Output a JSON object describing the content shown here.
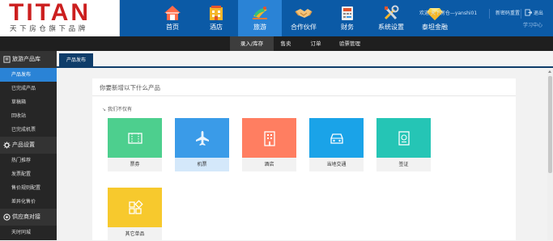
{
  "logo": {
    "title": "TITAN",
    "subtitle": "天下房仓旗下品牌"
  },
  "nav": [
    {
      "label": "首页",
      "icon": "home-icon"
    },
    {
      "label": "酒店",
      "icon": "hotel-icon"
    },
    {
      "label": "旅游",
      "icon": "travel-icon",
      "active": true
    },
    {
      "label": "合作伙伴",
      "icon": "handshake-icon"
    },
    {
      "label": "财务",
      "icon": "finance-icon"
    },
    {
      "label": "系统设置",
      "icon": "tools-icon"
    },
    {
      "label": "泰坦金融",
      "icon": "diamond-icon"
    }
  ],
  "userbar": {
    "user_text": "欢迎   天下房仓—yanshi01",
    "change_password": "新密码重置",
    "logout": "退出",
    "learn": "学习中心"
  },
  "subnav": [
    {
      "label": "录入/库存",
      "active": true
    },
    {
      "label": "售卖"
    },
    {
      "label": "订单"
    },
    {
      "label": "验票管理"
    }
  ],
  "sidebar": {
    "groups": [
      {
        "label": "旅游产品库",
        "icon": "product-library-icon",
        "items": [
          {
            "label": "产品发布",
            "active": true
          },
          {
            "label": "已完成产品"
          },
          {
            "label": "草稿箱"
          },
          {
            "label": "回收站"
          },
          {
            "label": "已完成机票"
          }
        ]
      },
      {
        "label": "产品设置",
        "icon": "gear-icon",
        "items": [
          {
            "label": "热门推荐"
          },
          {
            "label": "发票配置"
          },
          {
            "label": "售价规则配置"
          },
          {
            "label": "差异化售价"
          }
        ]
      },
      {
        "label": "供应商对接",
        "icon": "supplier-icon",
        "items": [
          {
            "label": "天时同城"
          }
        ]
      }
    ]
  },
  "tab": {
    "label": "产品发布"
  },
  "panel": {
    "title": "你要新增以下什么产品",
    "section_label": "我们不仅有",
    "cards": [
      {
        "label": "票券",
        "icon": "ticket-icon",
        "color": "#4dcf8e"
      },
      {
        "label": "机票",
        "icon": "airplane-icon",
        "color": "#3a9be8",
        "selected": true
      },
      {
        "label": "酒店",
        "icon": "building-icon",
        "color": "#ff7e61"
      },
      {
        "label": "当地交通",
        "icon": "car-icon",
        "color": "#1aa3e8"
      },
      {
        "label": "签证",
        "icon": "visa-icon",
        "color": "#25c5b5"
      },
      {
        "label": "其它单品",
        "icon": "grid-icon",
        "color": "#f7c92d"
      }
    ]
  },
  "colors": {
    "topbar": "#0b5aa6",
    "nav_active": "#2a83d6",
    "subnav": "#1f1f1f",
    "sidebar": "#262626",
    "tab": "#0f3d6a",
    "logo_red": "#cc1f1f"
  }
}
